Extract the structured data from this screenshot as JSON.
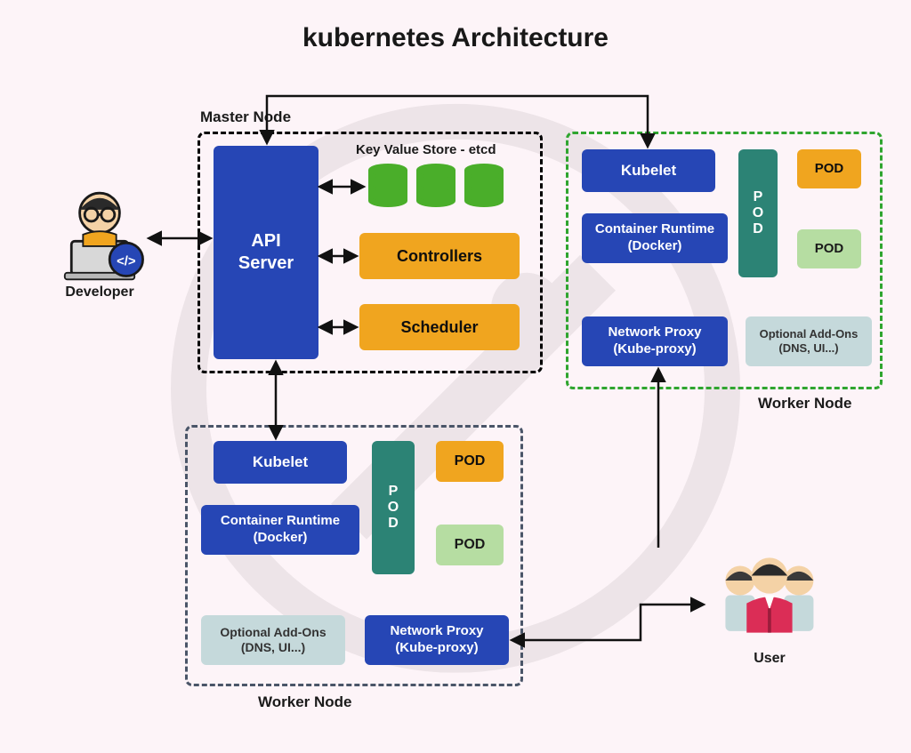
{
  "title": "kubernetes Architecture",
  "actors": {
    "developer": "Developer",
    "user": "User"
  },
  "master": {
    "label": "Master Node",
    "api_server": "API\nServer",
    "etcd_label": "Key Value Store - etcd",
    "controllers": "Controllers",
    "scheduler": "Scheduler"
  },
  "workerA": {
    "label": "Worker Node",
    "kubelet": "Kubelet",
    "pod_vert": "POD",
    "pod1": "POD",
    "pod2": "POD",
    "runtime": "Container Runtime\n(Docker)",
    "addons": "Optional Add-Ons\n(DNS, UI...)",
    "proxy": "Network Proxy\n(Kube-proxy)"
  },
  "workerB": {
    "label": "Worker Node",
    "kubelet": "Kubelet",
    "pod_vert": "POD",
    "pod1": "POD",
    "pod2": "POD",
    "runtime": "Container Runtime\n(Docker)",
    "addons": "Optional Add-Ons\n(DNS, UI...)",
    "proxy": "Network Proxy\n(Kube-proxy)"
  },
  "colors": {
    "blue": "#2646b5",
    "orange": "#f0a51f",
    "teal": "#2c8375",
    "mint": "#b6dda2",
    "pale": "#c5d9db",
    "green_dash": "#2fa52f",
    "etcd_green": "#4aae2a"
  }
}
